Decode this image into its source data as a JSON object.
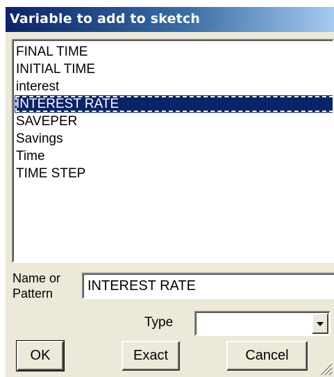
{
  "dialog": {
    "title": "Variable to add to sketch"
  },
  "variables": [
    {
      "label": "FINAL TIME",
      "selected": false
    },
    {
      "label": "INITIAL TIME",
      "selected": false
    },
    {
      "label": "interest",
      "selected": false
    },
    {
      "label": "INTEREST RATE",
      "selected": true
    },
    {
      "label": "SAVEPER",
      "selected": false
    },
    {
      "label": "Savings",
      "selected": false
    },
    {
      "label": "Time",
      "selected": false
    },
    {
      "label": "TIME STEP",
      "selected": false
    }
  ],
  "pattern": {
    "label_line1": "Name or",
    "label_line2": "Pattern",
    "value": "INTEREST RATE"
  },
  "type_field": {
    "label": "Type",
    "value": "",
    "icon": "chevron-down-icon"
  },
  "buttons": {
    "ok": "OK",
    "exact": "Exact",
    "cancel": "Cancel"
  },
  "colors": {
    "title_bar": "#0a246a",
    "selection": "#0a246a",
    "dialog_face": "#ece9d8"
  }
}
